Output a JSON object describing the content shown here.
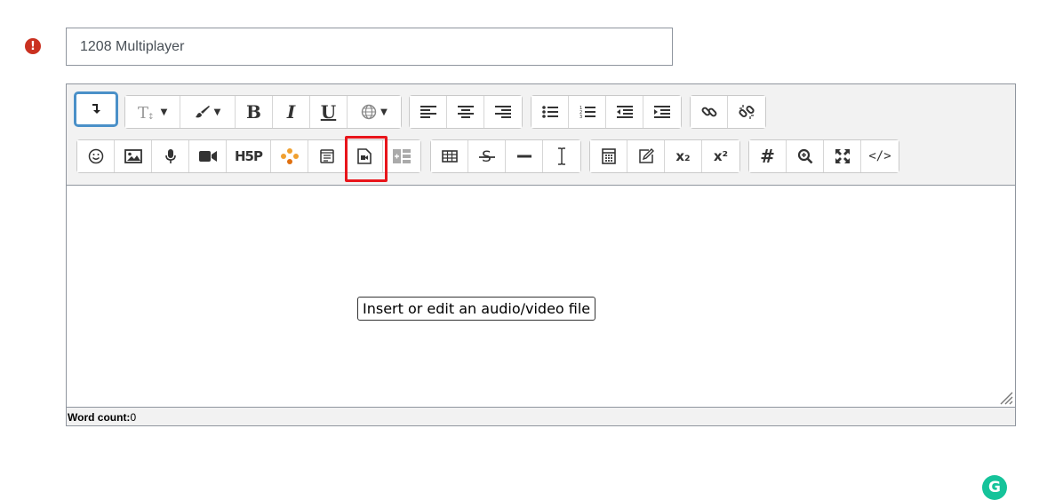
{
  "form": {
    "required_icon": "exclamation-circle-icon",
    "title_value": "1208 Multiplayer"
  },
  "toolbar": {
    "row1": [
      {
        "name": "collapse-toolbar-button",
        "icon": "arrow-down-icon"
      },
      {
        "name": "text-style-button",
        "icon": "text-style-icon"
      },
      {
        "name": "font-color-button",
        "icon": "paintbrush-icon"
      },
      {
        "name": "bold-button",
        "icon": "bold-icon",
        "label": "B"
      },
      {
        "name": "italic-button",
        "icon": "italic-icon",
        "label": "I"
      },
      {
        "name": "underline-button",
        "icon": "underline-icon",
        "label": "U"
      },
      {
        "name": "language-button",
        "icon": "globe-icon"
      },
      {
        "name": "align-left-button",
        "icon": "align-left-icon"
      },
      {
        "name": "align-center-button",
        "icon": "align-center-icon"
      },
      {
        "name": "align-right-button",
        "icon": "align-right-icon"
      },
      {
        "name": "unordered-list-button",
        "icon": "unordered-list-icon"
      },
      {
        "name": "ordered-list-button",
        "icon": "ordered-list-icon"
      },
      {
        "name": "outdent-button",
        "icon": "outdent-icon"
      },
      {
        "name": "indent-button",
        "icon": "indent-icon"
      },
      {
        "name": "link-button",
        "icon": "link-icon"
      },
      {
        "name": "unlink-button",
        "icon": "unlink-icon"
      }
    ],
    "row2": [
      {
        "name": "emoji-button",
        "icon": "smiley-icon"
      },
      {
        "name": "image-button",
        "icon": "image-icon"
      },
      {
        "name": "record-audio-button",
        "icon": "microphone-icon"
      },
      {
        "name": "record-video-button",
        "icon": "video-camera-icon"
      },
      {
        "name": "h5p-button",
        "icon": "h5p-icon",
        "label": "H5P"
      },
      {
        "name": "molecule-button",
        "icon": "molecule-icon"
      },
      {
        "name": "manage-files-button",
        "icon": "files-icon"
      },
      {
        "name": "media-button",
        "icon": "file-video-icon"
      },
      {
        "name": "widget-button",
        "icon": "widget-icon"
      },
      {
        "name": "table-button",
        "icon": "table-icon"
      },
      {
        "name": "strikethrough-button",
        "icon": "strikethrough-icon"
      },
      {
        "name": "horizontal-rule-button",
        "icon": "horizontal-rule-icon"
      },
      {
        "name": "cursor-button",
        "icon": "text-cursor-icon"
      },
      {
        "name": "equation-button",
        "icon": "calculator-icon"
      },
      {
        "name": "edit-button",
        "icon": "pencil-square-icon"
      },
      {
        "name": "subscript-button",
        "icon": "subscript-icon",
        "label": "x₂"
      },
      {
        "name": "superscript-button",
        "icon": "superscript-icon",
        "label": "x²"
      },
      {
        "name": "hashtag-button",
        "icon": "hashtag-icon",
        "label": "#"
      },
      {
        "name": "accessibility-checker-button",
        "icon": "zoom-icon"
      },
      {
        "name": "fullscreen-button",
        "icon": "expand-icon"
      },
      {
        "name": "html-button",
        "icon": "code-icon",
        "label": "</>"
      }
    ]
  },
  "tooltip": {
    "text": "Insert or edit an audio/video file"
  },
  "grammarly": {
    "icon": "grammarly-icon",
    "label": "G"
  },
  "status": {
    "label": "Word count:",
    "value": "0"
  },
  "colors": {
    "accent_focus": "#4a90c8",
    "highlight": "#e8151b",
    "error": "#ca3120",
    "grammarly": "#15c39a"
  }
}
